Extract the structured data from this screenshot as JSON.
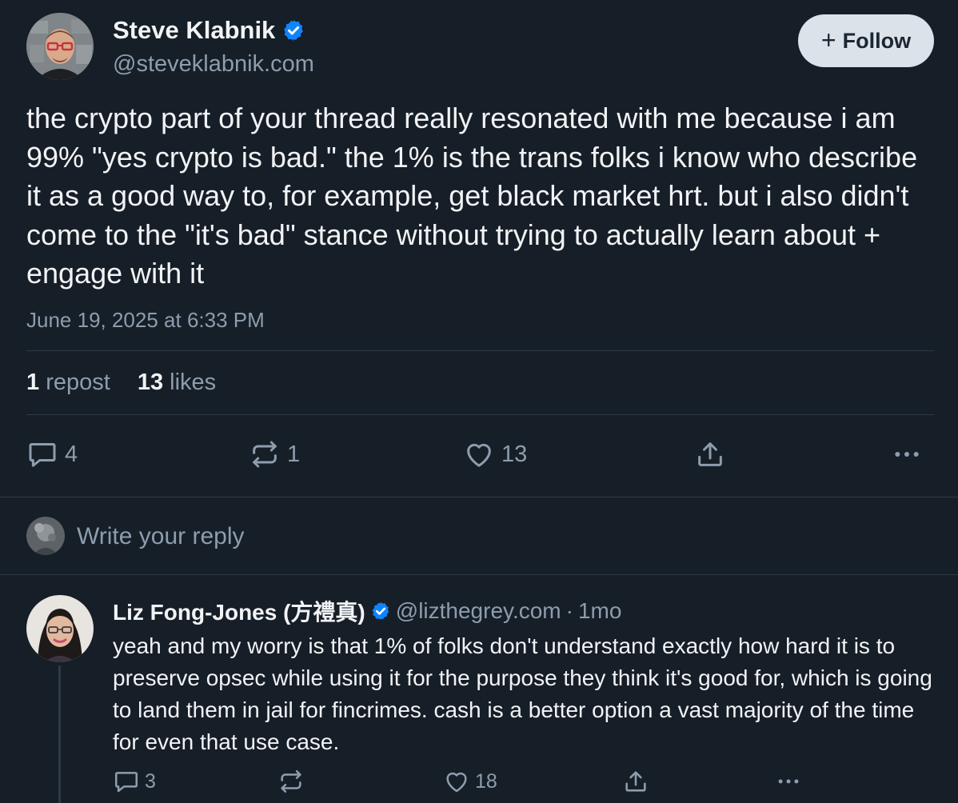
{
  "post": {
    "author": {
      "name": "Steve Klabnik",
      "handle": "@steveklabnik.com",
      "verified": true
    },
    "follow_label": "Follow",
    "text": "the crypto part of your thread really resonated with me because i am 99% \"yes crypto is bad.\" the 1% is the trans folks i know who describe it as a good way to, for example, get black market hrt. but i also didn't come to the \"it's bad\" stance without trying to actually learn about + engage with it",
    "timestamp": "June 19, 2025 at 6:33 PM",
    "stats": {
      "reposts_count": "1",
      "reposts_label": "repost",
      "likes_count": "13",
      "likes_label": "likes"
    },
    "actions": {
      "reply_count": "4",
      "repost_count": "1",
      "like_count": "13"
    }
  },
  "composer": {
    "placeholder": "Write your reply"
  },
  "reply": {
    "author": {
      "name": "Liz Fong-Jones (方禮真)",
      "handle": "@lizthegrey.com",
      "verified": true
    },
    "separator": "·",
    "time": "1mo",
    "text": "yeah and my worry is that 1% of folks don't understand exactly how hard it is to preserve opsec while using it for the purpose they think it's good for, which is going to land them in jail for fincrimes. cash is a better option a vast majority of the time for even that use case.",
    "actions": {
      "reply_count": "3",
      "like_count": "18"
    }
  },
  "colors": {
    "background": "#161E27",
    "text_primary": "#F1F3F5",
    "text_secondary": "#8D9DAE",
    "verified_blue": "#1083FE",
    "follow_button_bg": "#DCE2EA",
    "divider": "#2E3A48"
  },
  "icons": [
    "verified-badge-icon",
    "plus-icon",
    "comment-icon",
    "repost-icon",
    "heart-icon",
    "share-icon",
    "more-icon"
  ]
}
